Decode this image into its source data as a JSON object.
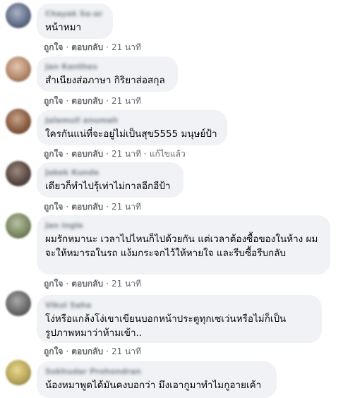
{
  "comments": [
    {
      "name": "Chayak Sa-ar ae",
      "text": "หน้าหมา",
      "like": "ถูกใจ",
      "reply": "ตอบกลับ",
      "time": "21 นาที",
      "edited": ""
    },
    {
      "name": "Jan Kanthes",
      "text": "สำเนียงส่อภาษา กิริยาส่อสกุล",
      "like": "ถูกใจ",
      "reply": "ตอบกลับ",
      "time": "21 นาที",
      "edited": ""
    },
    {
      "name": "Jalamull anumah",
      "text": "ใครกันแน่ที่จะอยู่ไม่เป็นสุข5555 มนุษย์ป้า",
      "like": "ถูกใจ",
      "reply": "ตอบกลับ",
      "time": "21 นาที",
      "edited": "แก้ไขแล้ว"
    },
    {
      "name": "Jakek Kunde",
      "text": "เดียวก็ทำไปรุ้เท่าไม่กาลอีกอีป้า",
      "like": "ถูกใจ",
      "reply": "ตอบกลับ",
      "time": "21 นาที",
      "edited": ""
    },
    {
      "name": "Jan ingle",
      "text": "ผมรักหมานะ เวลาไปไหนก็ไปด้วยกัน แต่เวลาต้องซื้อของในห้าง ผมจะให้หมารอในรถ แง้มกระจกไว้ให้หายใจ และรีบซื้อรีบกลับ",
      "like": "ถูกใจ",
      "reply": "ตอบกลับ",
      "time": "21 นาที",
      "edited": ""
    },
    {
      "name": "Vikul Saha",
      "text": "โง่หรือแกล้งโง่เขาเขียนบอกหน้าประตูทุกเซเว่นหรือไม่ก็เป็นรูปภาพหมาว่าห้ามเข้า..",
      "like": "ถูกใจ",
      "reply": "ตอบกลับ",
      "time": "21 นาที",
      "edited": ""
    },
    {
      "name": "Sokhudar Prohondran",
      "text": "น้องหมาพูดได้มันคงบอกว่า มึงเอากูมาทำไมกูอายเค้า",
      "like": "",
      "reply": "",
      "time": "",
      "edited": ""
    }
  ]
}
